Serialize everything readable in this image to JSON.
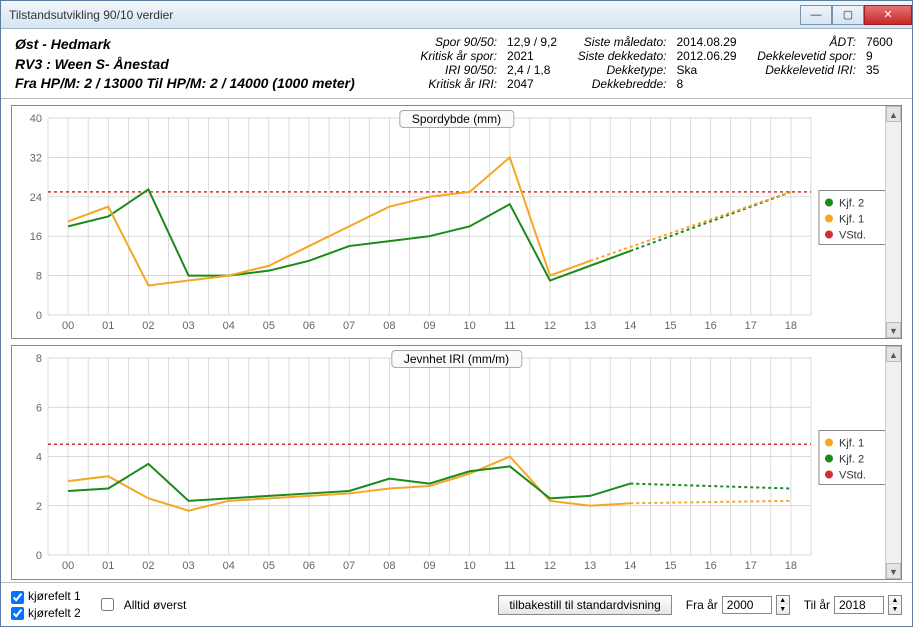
{
  "window_title": "Tilstandsutvikling 90/10 verdier",
  "header": {
    "region": "Øst - Hedmark",
    "route": "RV3 : Ween S- Ånestad",
    "hpstring": "Fra HP/M: 2 / 13000 Til HP/M: 2 / 14000 (1000 meter)",
    "labels": {
      "spor9050": "Spor 90/50:",
      "kritisk_spor": "Kritisk år spor:",
      "iri9050": "IRI 90/50:",
      "kritisk_iri": "Kritisk år IRI:",
      "siste_maledato": "Siste måledato:",
      "siste_dekkedato": "Siste dekkedato:",
      "dekketype": "Dekketype:",
      "dekkebredde": "Dekkebredde:",
      "adt": "ÅDT:",
      "dekkelevetid_spor": "Dekkelevetid spor:",
      "dekkelevetid_iri": "Dekkelevetid IRI:"
    },
    "values": {
      "spor9050": "12,9 / 9,2",
      "kritisk_spor": "2021",
      "iri9050": "2,4 / 1,8",
      "kritisk_iri": "2047",
      "siste_maledato": "2014.08.29",
      "siste_dekkedato": "2012.06.29",
      "dekketype": "Ska",
      "dekkebredde": "8",
      "adt": "7600",
      "dekkelevetid_spor": "9",
      "dekkelevetid_iri": "35"
    }
  },
  "bottom": {
    "kj1_label": "kjørefelt 1",
    "kj2_label": "kjørefelt 2",
    "always_top_label": "Alltid øverst",
    "reset_button": "tilbakestill til standardvisning",
    "from_label": "Fra år",
    "to_label": "Til år",
    "from_year": "2000",
    "to_year": "2018"
  },
  "legend_labels": {
    "kjf1": "Kjf. 1",
    "kjf2": "Kjf. 2",
    "vstd": "VStd."
  },
  "chart_data": [
    {
      "type": "line",
      "title": "Spordybde (mm)",
      "xlabel": "",
      "ylabel": "",
      "ylim": [
        0,
        40
      ],
      "yticks": [
        0,
        8,
        16,
        24,
        32,
        40
      ],
      "categories": [
        "00",
        "01",
        "02",
        "03",
        "04",
        "05",
        "06",
        "07",
        "08",
        "09",
        "10",
        "11",
        "12",
        "13",
        "14",
        "15",
        "16",
        "17",
        "18"
      ],
      "threshold": 25,
      "series": [
        {
          "name": "Kjf. 2",
          "color": "#1b8a1b",
          "values": [
            18,
            20,
            25.5,
            8,
            8,
            9,
            11,
            14,
            15,
            16,
            18,
            22.5,
            7,
            10,
            13,
            null,
            null,
            null,
            null
          ],
          "projection_from": 14,
          "projection_to_value": 25
        },
        {
          "name": "Kjf. 1",
          "color": "#f5a623",
          "values": [
            19,
            22,
            6,
            7,
            8,
            10,
            14,
            18,
            22,
            24,
            25,
            32,
            8,
            11,
            null,
            null,
            null,
            null,
            null
          ],
          "projection_from": 13,
          "projection_to_value": 25
        }
      ]
    },
    {
      "type": "line",
      "title": "Jevnhet IRI (mm/m)",
      "xlabel": "",
      "ylabel": "",
      "ylim": [
        0,
        8
      ],
      "yticks": [
        0,
        2,
        4,
        6,
        8
      ],
      "categories": [
        "00",
        "01",
        "02",
        "03",
        "04",
        "05",
        "06",
        "07",
        "08",
        "09",
        "10",
        "11",
        "12",
        "13",
        "14",
        "15",
        "16",
        "17",
        "18"
      ],
      "threshold": 4.5,
      "series": [
        {
          "name": "Kjf. 1",
          "color": "#f5a623",
          "values": [
            3.0,
            3.2,
            2.3,
            1.8,
            2.2,
            2.3,
            2.4,
            2.5,
            2.7,
            2.8,
            3.3,
            4.0,
            2.2,
            2.0,
            2.1,
            null,
            null,
            null,
            null
          ],
          "projection_from": 14,
          "projection_to_value": 2.2
        },
        {
          "name": "Kjf. 2",
          "color": "#1b8a1b",
          "values": [
            2.6,
            2.7,
            3.7,
            2.2,
            2.3,
            2.4,
            2.5,
            2.6,
            3.1,
            2.9,
            3.4,
            3.6,
            2.3,
            2.4,
            2.9,
            null,
            null,
            null,
            null
          ],
          "projection_from": 14,
          "projection_to_value": 2.7
        }
      ]
    }
  ]
}
